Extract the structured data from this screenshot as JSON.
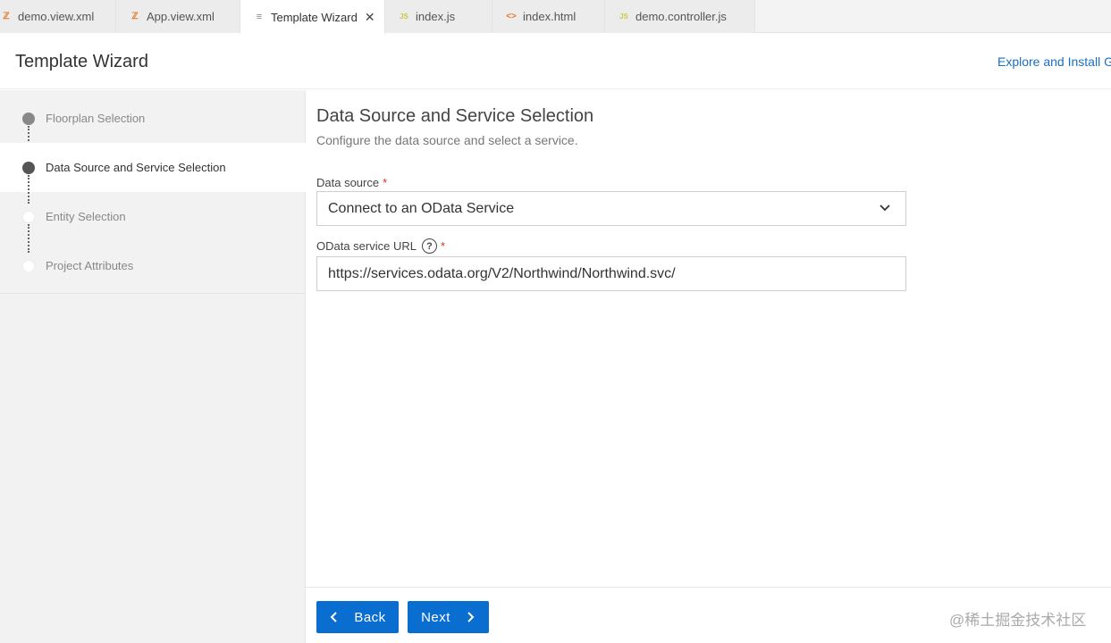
{
  "tabs": [
    {
      "label": "demo.view.xml",
      "icon": "xml-file-icon"
    },
    {
      "label": "App.view.xml",
      "icon": "xml-file-icon"
    },
    {
      "label": "Template Wizard",
      "icon": "document-icon",
      "active": true
    },
    {
      "label": "index.js",
      "icon": "js-file-icon"
    },
    {
      "label": "index.html",
      "icon": "html-file-icon"
    },
    {
      "label": "demo.controller.js",
      "icon": "js-file-icon"
    }
  ],
  "header": {
    "title": "Template Wizard",
    "explore_link": "Explore and Install Generators"
  },
  "steps": [
    {
      "label": "Floorplan Selection",
      "state": "done"
    },
    {
      "label": "Data Source and Service Selection",
      "state": "current"
    },
    {
      "label": "Entity Selection",
      "state": "todo"
    },
    {
      "label": "Project Attributes",
      "state": "todo"
    }
  ],
  "main": {
    "title": "Data Source and Service Selection",
    "subtitle": "Configure the data source and select a service.",
    "data_source": {
      "label": "Data source",
      "required_mark": "*",
      "value": "Connect to an OData Service"
    },
    "service_url": {
      "label": "OData service URL",
      "required_mark": "*",
      "help_glyph": "?",
      "value": "https://services.odata.org/V2/Northwind/Northwind.svc/"
    }
  },
  "footer": {
    "back_label": "Back",
    "next_label": "Next",
    "watermark": "@稀土掘金技术社区"
  },
  "colors": {
    "accent": "#0a6ed1",
    "link": "#1a6fbf",
    "required": "#d93025"
  }
}
